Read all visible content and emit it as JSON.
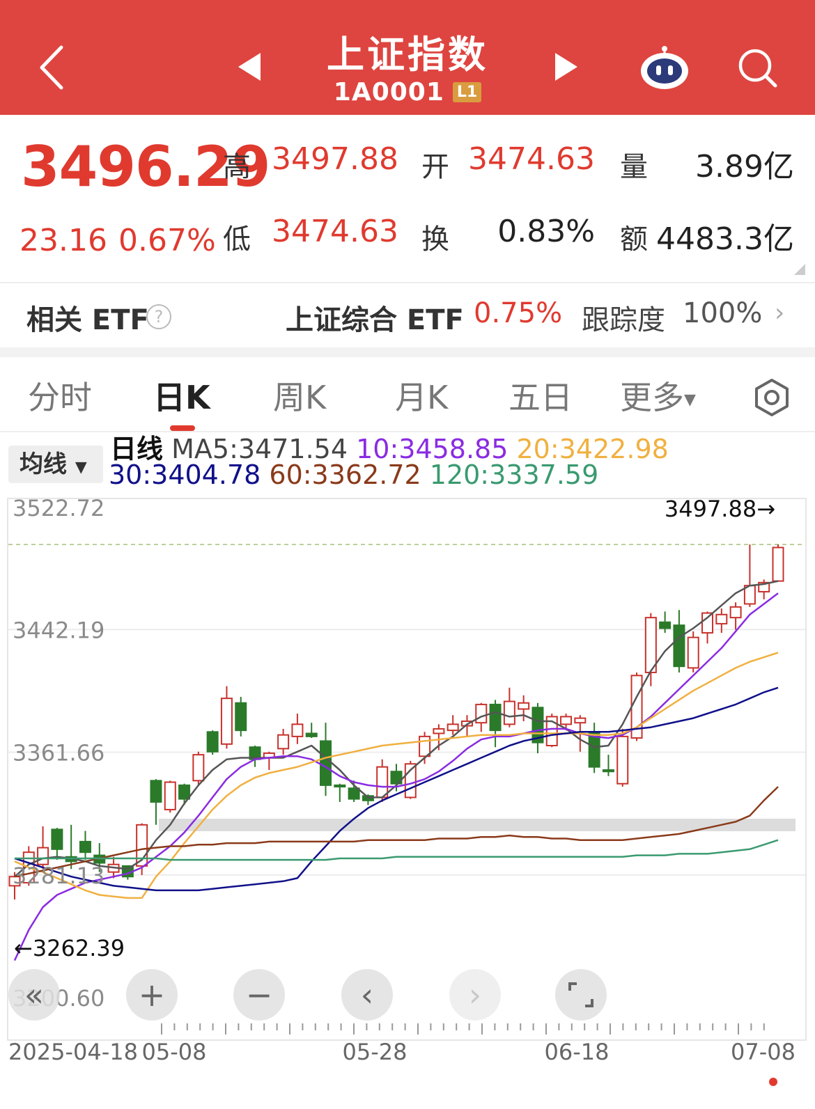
{
  "header": {
    "title": "上证指数",
    "code": "1A0001",
    "level": "L1"
  },
  "quote": {
    "price": "3496.29",
    "change": "23.16",
    "change_pct": "0.67%",
    "high_label": "高",
    "high": "3497.88",
    "open_label": "开",
    "open": "3474.63",
    "volume_label": "量",
    "volume": "3.89亿",
    "low_label": "低",
    "low": "3474.63",
    "turnover_label": "换",
    "turnover": "0.83%",
    "amount_label": "额",
    "amount": "4483.3亿"
  },
  "etf": {
    "label": "相关 ETF",
    "name": "上证综合 ETF",
    "pct": "0.75%",
    "track_label": "跟踪度",
    "track_value": "100%"
  },
  "tabs": [
    {
      "label": "分时"
    },
    {
      "label": "日K"
    },
    {
      "label": "周K"
    },
    {
      "label": "月K"
    },
    {
      "label": "五日"
    },
    {
      "label": "更多"
    }
  ],
  "ma": {
    "button": "均线",
    "title": "日线",
    "ma5": "MA5:3471.54",
    "ma10": "10:3458.85",
    "ma20": "20:3422.98",
    "ma30": "30:3404.78",
    "ma60": "60:3362.72",
    "ma120": "120:3337.59"
  },
  "colors": {
    "up": "#c8312b",
    "down": "#2a7a2a",
    "ma5": "#555555",
    "ma10": "#8a2be2",
    "ma20": "#f0b040",
    "ma30": "#10108a",
    "ma60": "#8a3a1a",
    "ma120": "#3a9a70"
  },
  "chart_data": {
    "type": "candlestick",
    "ylim": [
      3200.6,
      3522.72
    ],
    "y_ticks": [
      "3522.72",
      "3442.19",
      "3361.66",
      "3281.13",
      "3200.60"
    ],
    "x_labels": [
      "2025-04-18",
      "05-08",
      "05-28",
      "06-18",
      "07-08"
    ],
    "max_marker": "3497.88→",
    "min_marker": "←3262.39",
    "candles": [
      {
        "o": 3274,
        "c": 3280,
        "h": 3283,
        "l": 3265
      },
      {
        "o": 3276,
        "c": 3296,
        "h": 3300,
        "l": 3274
      },
      {
        "o": 3288,
        "c": 3299,
        "h": 3313,
        "l": 3285
      },
      {
        "o": 3311,
        "c": 3298,
        "h": 3312,
        "l": 3291
      },
      {
        "o": 3293,
        "c": 3290,
        "h": 3314,
        "l": 3285
      },
      {
        "o": 3303,
        "c": 3296,
        "h": 3310,
        "l": 3291
      },
      {
        "o": 3294,
        "c": 3289,
        "h": 3302,
        "l": 3283
      },
      {
        "o": 3283,
        "c": 3288,
        "h": 3293,
        "l": 3279
      },
      {
        "o": 3287,
        "c": 3280,
        "h": 3287,
        "l": 3278
      },
      {
        "o": 3287,
        "c": 3314,
        "h": 3315,
        "l": 3281
      },
      {
        "o": 3343,
        "c": 3329,
        "h": 3344,
        "l": 3314
      },
      {
        "o": 3324,
        "c": 3342,
        "h": 3343,
        "l": 3322
      },
      {
        "o": 3340,
        "c": 3331,
        "h": 3341,
        "l": 3327
      },
      {
        "o": 3343,
        "c": 3360,
        "h": 3362,
        "l": 3340
      },
      {
        "o": 3375,
        "c": 3362,
        "h": 3376,
        "l": 3360
      },
      {
        "o": 3367,
        "c": 3397,
        "h": 3405,
        "l": 3364
      },
      {
        "o": 3394,
        "c": 3376,
        "h": 3398,
        "l": 3372
      },
      {
        "o": 3365,
        "c": 3357,
        "h": 3366,
        "l": 3352
      },
      {
        "o": 3358,
        "c": 3361,
        "h": 3362,
        "l": 3350
      },
      {
        "o": 3364,
        "c": 3373,
        "h": 3377,
        "l": 3360
      },
      {
        "o": 3372,
        "c": 3380,
        "h": 3387,
        "l": 3367
      },
      {
        "o": 3374,
        "c": 3372,
        "h": 3381,
        "l": 3371
      },
      {
        "o": 3369,
        "c": 3340,
        "h": 3381,
        "l": 3333
      },
      {
        "o": 3340,
        "c": 3339,
        "h": 3341,
        "l": 3329
      },
      {
        "o": 3338,
        "c": 3331,
        "h": 3343,
        "l": 3329
      },
      {
        "o": 3333,
        "c": 3330,
        "h": 3334,
        "l": 3327
      },
      {
        "o": 3332,
        "c": 3352,
        "h": 3357,
        "l": 3329
      },
      {
        "o": 3349,
        "c": 3341,
        "h": 3354,
        "l": 3336
      },
      {
        "o": 3332,
        "c": 3354,
        "h": 3356,
        "l": 3331
      },
      {
        "o": 3359,
        "c": 3372,
        "h": 3375,
        "l": 3354
      },
      {
        "o": 3374,
        "c": 3377,
        "h": 3380,
        "l": 3363
      },
      {
        "o": 3376,
        "c": 3380,
        "h": 3386,
        "l": 3373
      },
      {
        "o": 3379,
        "c": 3382,
        "h": 3386,
        "l": 3372
      },
      {
        "o": 3381,
        "c": 3393,
        "h": 3394,
        "l": 3375
      },
      {
        "o": 3393,
        "c": 3376,
        "h": 3396,
        "l": 3365
      },
      {
        "o": 3380,
        "c": 3395,
        "h": 3404,
        "l": 3378
      },
      {
        "o": 3390,
        "c": 3394,
        "h": 3399,
        "l": 3382
      },
      {
        "o": 3391,
        "c": 3368,
        "h": 3394,
        "l": 3361
      },
      {
        "o": 3366,
        "c": 3385,
        "h": 3387,
        "l": 3365
      },
      {
        "o": 3380,
        "c": 3385,
        "h": 3387,
        "l": 3376
      },
      {
        "o": 3381,
        "c": 3384,
        "h": 3386,
        "l": 3362
      },
      {
        "o": 3375,
        "c": 3352,
        "h": 3381,
        "l": 3348
      },
      {
        "o": 3350,
        "c": 3349,
        "h": 3360,
        "l": 3346
      },
      {
        "o": 3341,
        "c": 3372,
        "h": 3377,
        "l": 3339
      },
      {
        "o": 3371,
        "c": 3412,
        "h": 3414,
        "l": 3369
      },
      {
        "o": 3414,
        "c": 3450,
        "h": 3453,
        "l": 3405
      },
      {
        "o": 3447,
        "c": 3443,
        "h": 3454,
        "l": 3440
      },
      {
        "o": 3445,
        "c": 3418,
        "h": 3455,
        "l": 3414
      },
      {
        "o": 3417,
        "c": 3437,
        "h": 3441,
        "l": 3414
      },
      {
        "o": 3440,
        "c": 3453,
        "h": 3454,
        "l": 3433
      },
      {
        "o": 3446,
        "c": 3452,
        "h": 3456,
        "l": 3440
      },
      {
        "o": 3450,
        "c": 3457,
        "h": 3460,
        "l": 3442
      },
      {
        "o": 3459,
        "c": 3471,
        "h": 3498,
        "l": 3457
      },
      {
        "o": 3467,
        "c": 3473,
        "h": 3475,
        "l": 3462
      },
      {
        "o": 3474,
        "c": 3496,
        "h": 3498,
        "l": 3474
      }
    ],
    "series": [
      {
        "name": "MA5",
        "values": [
          3280,
          3288,
          3292,
          3293,
          3292,
          3290,
          3287,
          3286,
          3285,
          3291,
          3304,
          3314,
          3328,
          3340,
          3350,
          3357,
          3358,
          3358,
          3358,
          3358,
          3362,
          3366,
          3358,
          3350,
          3340,
          3332,
          3332,
          3340,
          3350,
          3358,
          3366,
          3372,
          3380,
          3385,
          3388,
          3385,
          3386,
          3382,
          3382,
          3377,
          3370,
          3365,
          3366,
          3380,
          3398,
          3415,
          3428,
          3437,
          3443,
          3450,
          3458,
          3466,
          3471,
          3472,
          3474
        ]
      },
      {
        "name": "10",
        "values": [
          3225,
          3245,
          3260,
          3268,
          3272,
          3276,
          3278,
          3280,
          3282,
          3286,
          3293,
          3300,
          3309,
          3320,
          3332,
          3344,
          3352,
          3357,
          3358,
          3359,
          3359,
          3357,
          3352,
          3346,
          3342,
          3340,
          3339,
          3339,
          3341,
          3344,
          3349,
          3356,
          3364,
          3370,
          3372,
          3372,
          3374,
          3376,
          3377,
          3377,
          3374,
          3372,
          3371,
          3373,
          3378,
          3385,
          3394,
          3403,
          3412,
          3421,
          3430,
          3441,
          3452,
          3459,
          3466
        ]
      },
      {
        "name": "20",
        "values": [
          3290,
          3286,
          3283,
          3279,
          3275,
          3271,
          3268,
          3267,
          3266,
          3266,
          3280,
          3290,
          3302,
          3313,
          3324,
          3333,
          3340,
          3345,
          3348,
          3350,
          3352,
          3355,
          3358,
          3360,
          3362,
          3364,
          3366,
          3367,
          3368,
          3369,
          3370,
          3371,
          3372,
          3373,
          3373,
          3373,
          3374,
          3374,
          3374,
          3374,
          3374,
          3373,
          3373,
          3374,
          3378,
          3384,
          3390,
          3396,
          3402,
          3407,
          3412,
          3417,
          3421,
          3424,
          3427
        ]
      },
      {
        "name": "30",
        "values": [
          3292,
          3289,
          3286,
          3283,
          3280,
          3278,
          3276,
          3274,
          3273,
          3272,
          3271,
          3271,
          3271,
          3271,
          3272,
          3273,
          3274,
          3275,
          3276,
          3277,
          3279,
          3290,
          3300,
          3310,
          3318,
          3325,
          3330,
          3334,
          3338,
          3342,
          3346,
          3350,
          3354,
          3358,
          3362,
          3366,
          3369,
          3371,
          3373,
          3374,
          3375,
          3375,
          3375,
          3376,
          3377,
          3378,
          3380,
          3382,
          3384,
          3387,
          3390,
          3393,
          3397,
          3401,
          3404
        ]
      },
      {
        "name": "60",
        "values": [
          3280,
          3282,
          3284,
          3286,
          3288,
          3290,
          3292,
          3294,
          3296,
          3298,
          3299,
          3300,
          3300,
          3301,
          3301,
          3302,
          3302,
          3302,
          3303,
          3303,
          3303,
          3303,
          3303,
          3303,
          3303,
          3304,
          3304,
          3304,
          3304,
          3304,
          3305,
          3305,
          3305,
          3306,
          3306,
          3307,
          3306,
          3306,
          3305,
          3305,
          3304,
          3304,
          3304,
          3304,
          3305,
          3306,
          3307,
          3308,
          3310,
          3312,
          3314,
          3316,
          3320,
          3330,
          3339
        ]
      },
      {
        "name": "120",
        "values": [
          3292,
          3292,
          3292,
          3292,
          3292,
          3292,
          3292,
          3292,
          3292,
          3292,
          3292,
          3291,
          3291,
          3291,
          3291,
          3291,
          3291,
          3291,
          3291,
          3291,
          3291,
          3291,
          3291,
          3292,
          3292,
          3292,
          3292,
          3293,
          3293,
          3293,
          3293,
          3293,
          3293,
          3293,
          3293,
          3293,
          3293,
          3293,
          3293,
          3293,
          3293,
          3293,
          3293,
          3293,
          3294,
          3294,
          3294,
          3295,
          3295,
          3295,
          3296,
          3297,
          3298,
          3301,
          3304
        ]
      }
    ]
  }
}
